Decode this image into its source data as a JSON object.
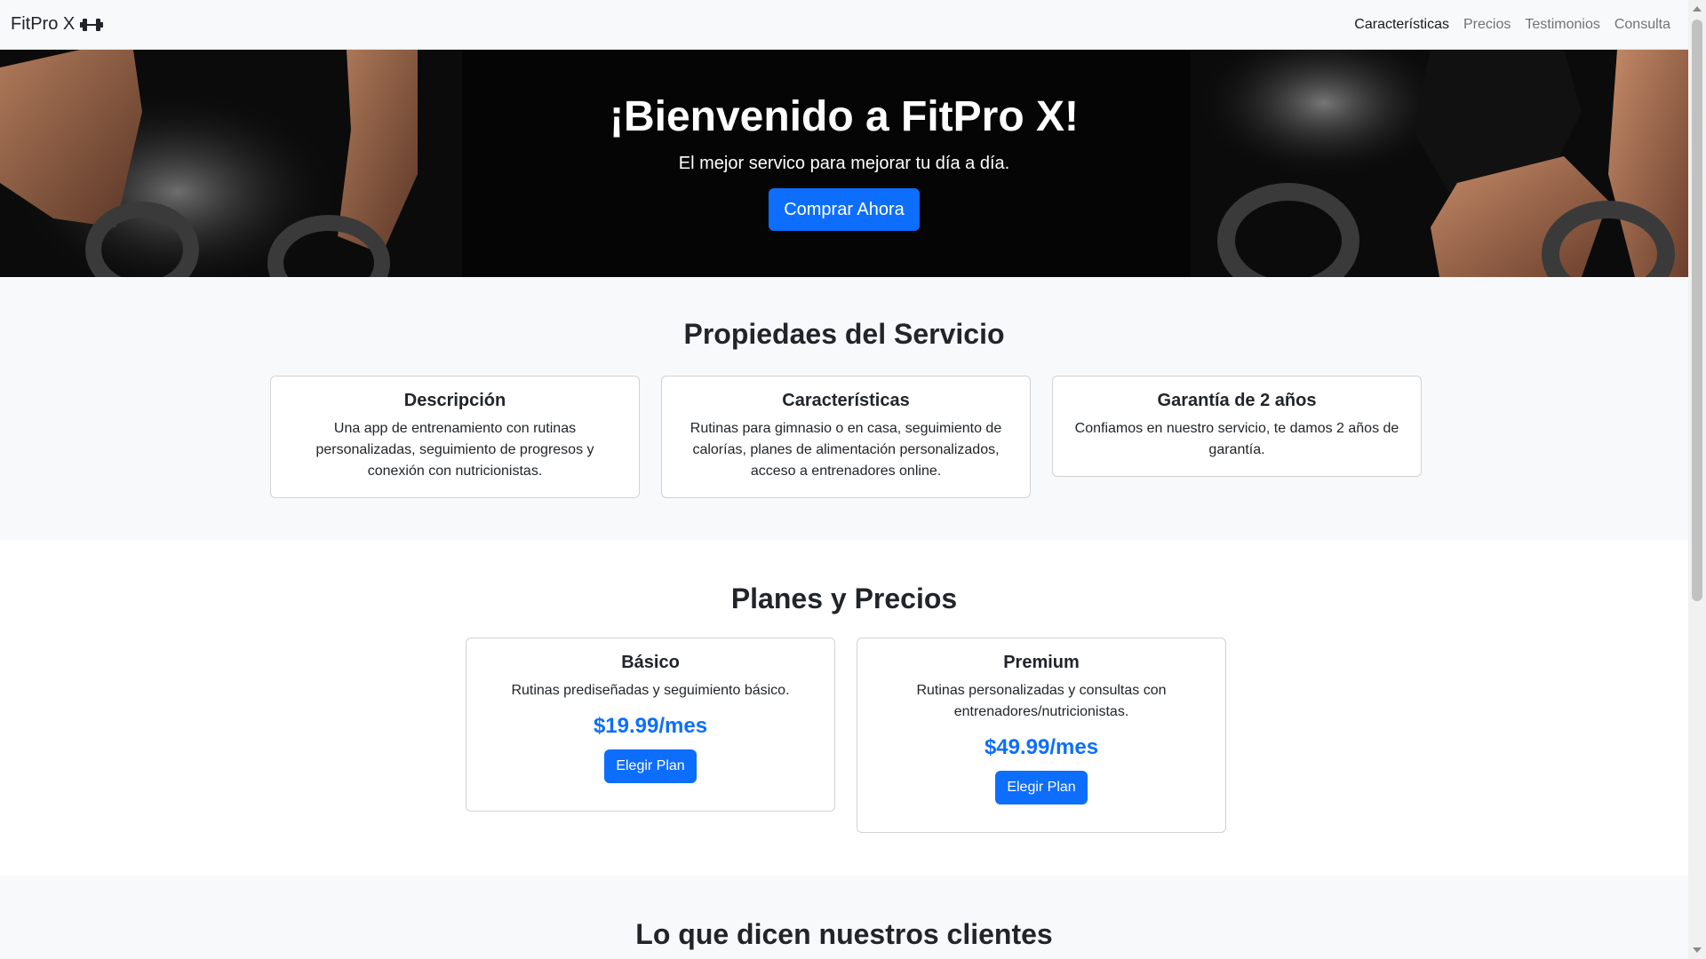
{
  "navbar": {
    "brand": "FitPro X",
    "brand_icon": "dumbbell-icon",
    "links": [
      {
        "label": "Características",
        "active": true
      },
      {
        "label": "Precios",
        "active": false
      },
      {
        "label": "Testimonios",
        "active": false
      },
      {
        "label": "Consulta",
        "active": false
      }
    ]
  },
  "hero": {
    "title": "¡Bienvenido a FitPro X!",
    "subtitle": "El mejor servico para mejorar tu día a día.",
    "cta_label": "Comprar Ahora"
  },
  "features": {
    "title": "Propiedaes del Servicio",
    "cards": [
      {
        "title": "Descripción",
        "text": "Una app de entrenamiento con rutinas personalizadas, seguimiento de progresos y conexión con nutricionistas."
      },
      {
        "title": "Características",
        "text": "Rutinas para gimnasio o en casa, seguimiento de calorías, planes de alimentación personalizados, acceso a entrenadores online."
      },
      {
        "title": "Garantía de 2 años",
        "text": "Confiamos en nuestro servicio, te damos 2 años de garantía."
      }
    ]
  },
  "pricing": {
    "title": "Planes y Precios",
    "plans": [
      {
        "name": "Básico",
        "description": "Rutinas prediseñadas y seguimiento básico.",
        "price": "$19.99/mes",
        "button": "Elegir Plan"
      },
      {
        "name": "Premium",
        "description": "Rutinas personalizadas y consultas con entrenadores/nutricionistas.",
        "price": "$49.99/mes",
        "button": "Elegir Plan"
      }
    ]
  },
  "testimonials": {
    "title": "Lo que dicen nuestros clientes"
  },
  "colors": {
    "primary": "#0d6efd",
    "light_bg": "#f8f9fa",
    "text": "#212529"
  }
}
